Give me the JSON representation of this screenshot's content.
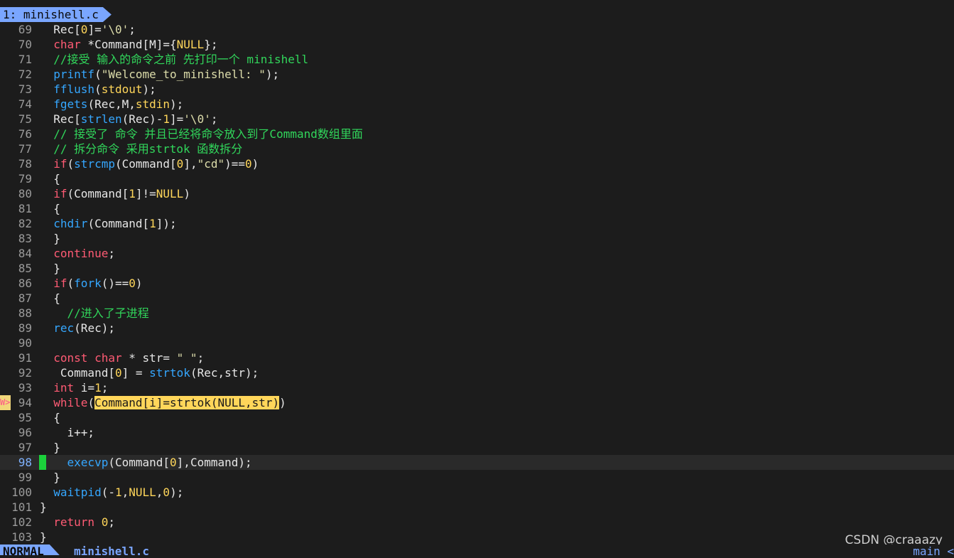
{
  "tab": {
    "label": "1: minishell.c"
  },
  "sign_warning": "W>",
  "lines": [
    {
      "n": "69",
      "html": "  Rec[<span class=\"num\">0</span>]=<span class=\"str\">'\\0'</span>;"
    },
    {
      "n": "70",
      "html": "  <span class=\"kw\">char</span> *Command[M]={<span class=\"yl\">NULL</span>};"
    },
    {
      "n": "71",
      "html": "  <span class=\"cmt\">//接受 输入的命令之前 先打印一个 minishell</span>"
    },
    {
      "n": "72",
      "html": "  <span class=\"fn\">printf</span>(<span class=\"str\">\"Welcome_to_minishell: \"</span>);"
    },
    {
      "n": "73",
      "html": "  <span class=\"fn\">fflush</span>(<span class=\"yl\">stdout</span>);"
    },
    {
      "n": "74",
      "html": "  <span class=\"fn\">fgets</span>(Rec,M,<span class=\"yl\">stdin</span>);"
    },
    {
      "n": "75",
      "html": "  Rec[<span class=\"fn\">strlen</span>(Rec)-<span class=\"num\">1</span>]=<span class=\"str\">'\\0'</span>;"
    },
    {
      "n": "76",
      "html": "  <span class=\"cmt\">// 接受了 命令 并且已经将命令放入到了Command数组里面</span>"
    },
    {
      "n": "77",
      "html": "  <span class=\"cmt\">// 拆分命令 采用strtok 函数拆分</span>"
    },
    {
      "n": "78",
      "html": "  <span class=\"kw\">if</span>(<span class=\"fn\">strcmp</span>(Command[<span class=\"num\">0</span>],<span class=\"str\">\"cd\"</span>)==<span class=\"num\">0</span>)"
    },
    {
      "n": "79",
      "html": "  {"
    },
    {
      "n": "80",
      "html": "  <span class=\"kw\">if</span>(Command[<span class=\"num\">1</span>]!=<span class=\"yl\">NULL</span>)"
    },
    {
      "n": "81",
      "html": "  {"
    },
    {
      "n": "82",
      "html": "  <span class=\"fn\">chdir</span>(Command[<span class=\"num\">1</span>]);"
    },
    {
      "n": "83",
      "html": "  }"
    },
    {
      "n": "84",
      "html": "  <span class=\"kw\">continue</span>;"
    },
    {
      "n": "85",
      "html": "  }"
    },
    {
      "n": "86",
      "html": "  <span class=\"kw\">if</span>(<span class=\"fn\">fork</span>()==<span class=\"num\">0</span>)"
    },
    {
      "n": "87",
      "html": "  {"
    },
    {
      "n": "88",
      "html": "    <span class=\"cmt\">//进入了子进程</span>"
    },
    {
      "n": "89",
      "html": "  <span class=\"fn\">rec</span>(Rec);"
    },
    {
      "n": "90",
      "html": ""
    },
    {
      "n": "91",
      "html": "  <span class=\"kw\">const char</span> * str= <span class=\"str\">\" \"</span>;"
    },
    {
      "n": "92",
      "html": "   Command[<span class=\"num\">0</span>] = <span class=\"fn\">strtok</span>(Rec,str);"
    },
    {
      "n": "93",
      "html": "  <span class=\"kw\">int</span> i=<span class=\"num\">1</span>;"
    },
    {
      "n": "94",
      "html": "  <span class=\"kw\">while</span>(<span class=\"hl\">Command[i]=strtok(NULL,str)</span>)",
      "warn": true
    },
    {
      "n": "95",
      "html": "  {"
    },
    {
      "n": "96",
      "html": "    i++;"
    },
    {
      "n": "97",
      "html": "  }"
    },
    {
      "n": "98",
      "html": "    <span class=\"fn\">execvp</span>(Command[<span class=\"num\">0</span>],Command);",
      "current": true
    },
    {
      "n": "99",
      "html": "  }"
    },
    {
      "n": "100",
      "html": "  <span class=\"fn\">waitpid</span>(-<span class=\"num\">1</span>,<span class=\"yl\">NULL</span>,<span class=\"num\">0</span>);"
    },
    {
      "n": "101",
      "html": "}"
    },
    {
      "n": "102",
      "html": "  <span class=\"kw\">return</span> <span class=\"num\">0</span>;"
    },
    {
      "n": "103",
      "html": "}"
    }
  ],
  "status": {
    "mode": "NORMAL",
    "filename": "minishell.c",
    "branch": "main <"
  },
  "watermark": "CSDN @craaazy",
  "colors": {
    "accent": "#7aa6ff",
    "keyword": "#ff5b74",
    "function": "#35a7ff",
    "comment": "#31d65b",
    "number": "#ffd65a",
    "sign_mark": "#1bd13b"
  }
}
